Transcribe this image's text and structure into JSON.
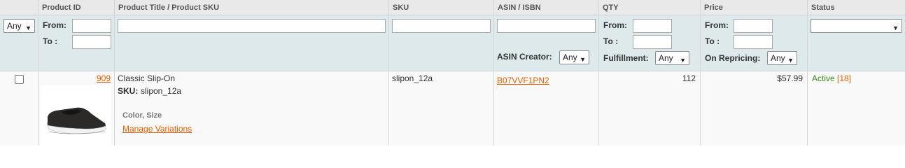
{
  "headers": {
    "checkbox": "",
    "product_id": "Product ID",
    "title": "Product Title / Product SKU",
    "sku": "SKU",
    "asin": "ASIN / ISBN",
    "qty": "QTY",
    "price": "Price",
    "status": "Status"
  },
  "filters": {
    "select_any": "Any",
    "from_label": "From:",
    "to_label": "To :",
    "asin_creator_label": "ASIN Creator:",
    "asin_creator_value": "Any",
    "fulfillment_label": "Fulfillment:",
    "fulfillment_value": "Any",
    "on_repricing_label": "On Repricing:",
    "on_repricing_value": "Any",
    "status_value": ""
  },
  "row": {
    "product_id": "909",
    "title": "Classic Slip-On",
    "sku_label": "SKU:",
    "sku_value": "slipon_12a",
    "attributes": "Color, Size",
    "manage_variations": "Manage Variations",
    "sku_col": "slipon_12a",
    "asin": "B07VVF1PN2",
    "qty": "112",
    "price": "$57.99",
    "status": "Active",
    "status_count": "[18]"
  },
  "icons": {
    "dropdown": "chevron-down-icon",
    "product_image": "slip-on-shoe-image"
  }
}
